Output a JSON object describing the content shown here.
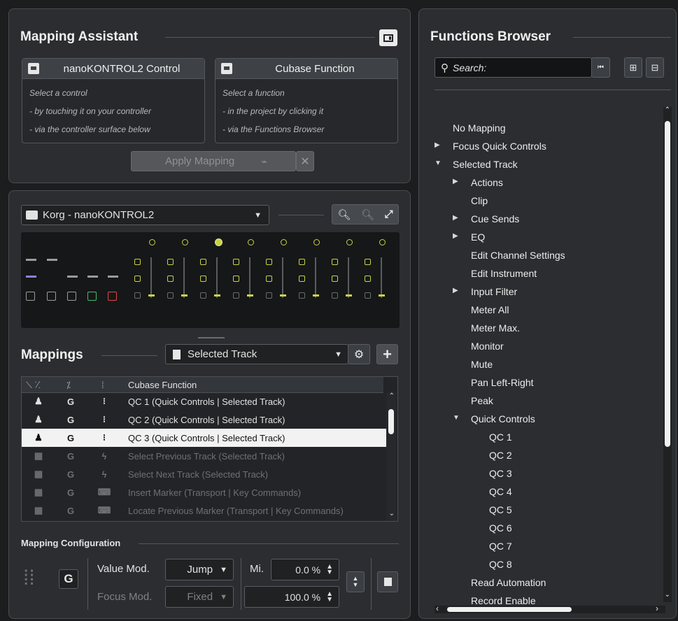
{
  "mapping_assistant": {
    "title": "Mapping Assistant",
    "controller_card": {
      "label": "nanoKONTROL2 Control",
      "hints": [
        "Select a control",
        "- by touching it on your controller",
        "- via the controller surface below"
      ]
    },
    "function_card": {
      "label": "Cubase Function",
      "hints": [
        "Select a function",
        "- in the project by clicking it",
        "- via the Functions Browser"
      ]
    },
    "apply_button": "Apply Mapping"
  },
  "device": {
    "selected": "Korg - nanoKONTROL2"
  },
  "mappings": {
    "title": "Mappings",
    "page_selector": "Selected Track",
    "columns": [
      "",
      "",
      "",
      "Cubase Function"
    ],
    "rows": [
      {
        "c1": "♟",
        "c2": "G",
        "c3": "⁝",
        "func": "QC 1 (Quick Controls | Selected Track)",
        "state": "normal"
      },
      {
        "c1": "♟",
        "c2": "G",
        "c3": "⁝",
        "func": "QC 2 (Quick Controls | Selected Track)",
        "state": "normal"
      },
      {
        "c1": "♟",
        "c2": "G",
        "c3": "⁝",
        "func": "QC 3 (Quick Controls | Selected Track)",
        "state": "selected"
      },
      {
        "c1": "▦",
        "c2": "G",
        "c3": "ϟ",
        "func": "Select Previous Track (Selected Track)",
        "state": "dim"
      },
      {
        "c1": "▦",
        "c2": "G",
        "c3": "ϟ",
        "func": "Select Next Track (Selected Track)",
        "state": "dim"
      },
      {
        "c1": "▦",
        "c2": "G",
        "c3": "⌨",
        "func": "Insert Marker (Transport | Key Commands)",
        "state": "dim"
      },
      {
        "c1": "▦",
        "c2": "G",
        "c3": "⌨",
        "func": "Locate Previous Marker (Transport | Key Commands)",
        "state": "dim"
      }
    ]
  },
  "mapping_configuration": {
    "title": "Mapping Configuration",
    "global_badge": "G",
    "value_mode_label": "Value Mod.",
    "value_mode": "Jump",
    "focus_mode_label": "Focus Mod.",
    "focus_mode": "Fixed",
    "min_label": "Mi.",
    "min_value": "0.0 %",
    "max_value": "100.0 %"
  },
  "functions_browser": {
    "title": "Functions Browser",
    "search_placeholder": "Search:",
    "tree": [
      {
        "label": "No Mapping",
        "level": 0,
        "arrow": ""
      },
      {
        "label": "Focus Quick Controls",
        "level": 0,
        "arrow": "▶"
      },
      {
        "label": "Selected Track",
        "level": 0,
        "arrow": "▼"
      },
      {
        "label": "Actions",
        "level": 1,
        "arrow": "▶"
      },
      {
        "label": "Clip",
        "level": 1,
        "arrow": ""
      },
      {
        "label": "Cue Sends",
        "level": 1,
        "arrow": "▶"
      },
      {
        "label": "EQ",
        "level": 1,
        "arrow": "▶"
      },
      {
        "label": "Edit Channel Settings",
        "level": 1,
        "arrow": ""
      },
      {
        "label": "Edit Instrument",
        "level": 1,
        "arrow": ""
      },
      {
        "label": "Input Filter",
        "level": 1,
        "arrow": "▶"
      },
      {
        "label": "Meter All",
        "level": 1,
        "arrow": ""
      },
      {
        "label": "Meter Max.",
        "level": 1,
        "arrow": ""
      },
      {
        "label": "Monitor",
        "level": 1,
        "arrow": ""
      },
      {
        "label": "Mute",
        "level": 1,
        "arrow": ""
      },
      {
        "label": "Pan Left-Right",
        "level": 1,
        "arrow": ""
      },
      {
        "label": "Peak",
        "level": 1,
        "arrow": ""
      },
      {
        "label": "Quick Controls",
        "level": 1,
        "arrow": "▼"
      },
      {
        "label": "QC 1",
        "level": 2,
        "arrow": ""
      },
      {
        "label": "QC 2",
        "level": 2,
        "arrow": ""
      },
      {
        "label": "QC 3",
        "level": 2,
        "arrow": ""
      },
      {
        "label": "QC 4",
        "level": 2,
        "arrow": ""
      },
      {
        "label": "QC 5",
        "level": 2,
        "arrow": ""
      },
      {
        "label": "QC 6",
        "level": 2,
        "arrow": ""
      },
      {
        "label": "QC 7",
        "level": 2,
        "arrow": ""
      },
      {
        "label": "QC 8",
        "level": 2,
        "arrow": ""
      },
      {
        "label": "Read Automation",
        "level": 1,
        "arrow": ""
      },
      {
        "label": "Record Enable",
        "level": 1,
        "arrow": ""
      }
    ]
  },
  "colors": {
    "accent": "#c9d24a",
    "selected_row": "#f2f2f2",
    "panel": "#2b2d30",
    "background": "#1c1d1f"
  }
}
